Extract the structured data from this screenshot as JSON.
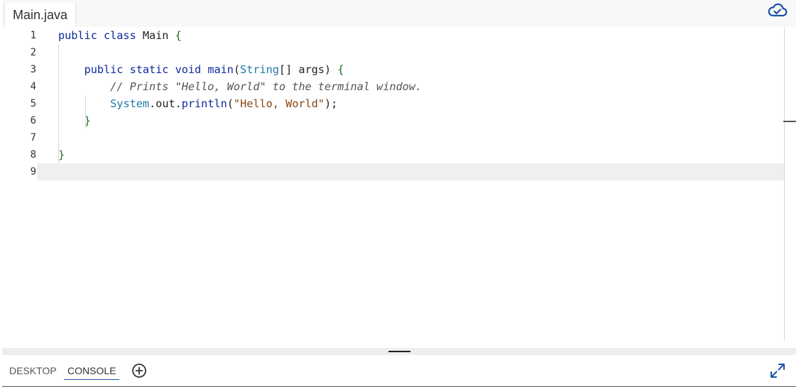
{
  "file_tab": {
    "label": "Main.java"
  },
  "icons": {
    "cloud": "cloud-check-icon",
    "add": "plus-circle-icon",
    "expand": "expand-diagonal-icon"
  },
  "colors": {
    "accent": "#1a4fa8",
    "keyword": "#0d2a9b",
    "string": "#8a4614",
    "bracket": "#1a6e1a"
  },
  "editor": {
    "line_numbers": [
      "1",
      "2",
      "3",
      "4",
      "5",
      "6",
      "7",
      "8",
      "9"
    ],
    "lines": [
      {
        "indent": "",
        "tokens": [
          {
            "c": "kw",
            "t": "public class "
          },
          {
            "c": "",
            "t": "Main "
          },
          {
            "c": "br",
            "t": "{"
          }
        ]
      },
      {
        "indent": "",
        "tokens": []
      },
      {
        "indent": "    ",
        "tokens": [
          {
            "c": "kw",
            "t": "public static void "
          },
          {
            "c": "fn",
            "t": "main"
          },
          {
            "c": "",
            "t": "("
          },
          {
            "c": "typ",
            "t": "String"
          },
          {
            "c": "",
            "t": "[] args) "
          },
          {
            "c": "br",
            "t": "{"
          }
        ]
      },
      {
        "indent": "        ",
        "tokens": [
          {
            "c": "cm",
            "t": "// Prints \"Hello, World\" to the terminal window."
          }
        ]
      },
      {
        "indent": "        ",
        "tokens": [
          {
            "c": "typ",
            "t": "System"
          },
          {
            "c": "",
            "t": ".out."
          },
          {
            "c": "fn",
            "t": "println"
          },
          {
            "c": "",
            "t": "("
          },
          {
            "c": "str",
            "t": "\"Hello, World\""
          },
          {
            "c": "",
            "t": ");"
          }
        ]
      },
      {
        "indent": "    ",
        "tokens": [
          {
            "c": "br",
            "t": "}"
          }
        ]
      },
      {
        "indent": "",
        "tokens": []
      },
      {
        "indent": "",
        "tokens": [
          {
            "c": "br",
            "t": "}"
          }
        ]
      },
      {
        "indent": "",
        "tokens": []
      }
    ],
    "current_line": 9
  },
  "bottom_tabs": [
    {
      "label": "DESKTOP",
      "active": false
    },
    {
      "label": "CONSOLE",
      "active": true
    }
  ]
}
